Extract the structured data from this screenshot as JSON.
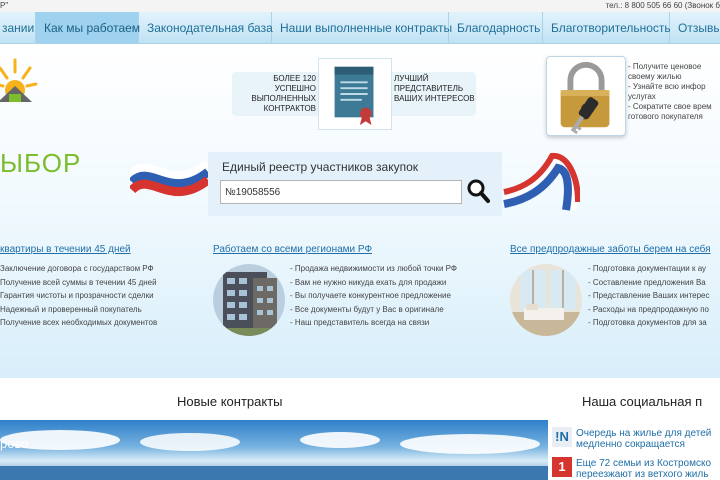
{
  "topbar": {
    "left_text": "Р\"",
    "right_text": "тел.: 8 800 505 66 60 (Звонок б"
  },
  "nav": {
    "items": [
      {
        "label": "зании"
      },
      {
        "label": "Как мы работаем"
      },
      {
        "label": "Законодательная база"
      },
      {
        "label": "Наши выполненные контракты"
      },
      {
        "label": "Благодарность"
      },
      {
        "label": "Благотворительность"
      },
      {
        "label": "Отзывы"
      }
    ]
  },
  "logo": {
    "text": "ЫБОР"
  },
  "stats": {
    "left": "БОЛЕЕ 120 УСПЕШНО ВЫПОЛНЕННЫХ КОНТРАКТОВ",
    "right": "ЛУЧШИЙ ПРЕДСТАВИТЕЛЬ ВАШИХ ИНТЕРЕСОВ"
  },
  "top_bullets": [
    "- Получите ценовое",
    "своему жилью",
    "- Узнайте всю инфор",
    "услугах",
    "- Сократите свое врем",
    "готового покупателя"
  ],
  "search": {
    "title": "Единый реестр участников закупок",
    "value": "№19058556"
  },
  "columns": [
    {
      "title": "квартиры в течении 45 дней",
      "items": [
        "Заключение договора с государством РФ",
        "Получение всей суммы в течении 45 дней",
        "Гарантия чистоты и прозрачности сделки",
        "Надежный и проверенный покупатель",
        "Получение всех необходимых документов"
      ]
    },
    {
      "title": "Работаем со всеми регионами РФ",
      "items": [
        "- Продажа недвижимости из любой точки РФ",
        "- Вам не нужно никуда ехать для продажи",
        "- Вы получаете конкурентное предложение",
        "- Все документы будут у Вас в оригинале",
        "- Наш представитель всегда на связи"
      ]
    },
    {
      "title": "Все предпродажные заботы берем на себя",
      "items": [
        "- Подготовка документации к ау",
        "- Составление предложения Ва",
        "- Представление Ваших интерес",
        "- Расходы на предпродажную по",
        "- Подготовка документов для за"
      ]
    }
  ],
  "sections": {
    "contracts_title": "Новые контракты",
    "social_title": "Наша социальная п"
  },
  "news": {
    "title": "рово"
  },
  "social": [
    {
      "icon": "!N",
      "text": [
        "Очередь на жилье для детей",
        "медленно сокращается"
      ]
    },
    {
      "icon": "1",
      "text": [
        "Еще 72 семьи из Костромско",
        "переезжают из ветхого жиль"
      ]
    }
  ],
  "colors": {
    "accent": "#1f6fa8",
    "nav_bg": "#bfe2f4",
    "logo_green": "#7cbd2c"
  }
}
